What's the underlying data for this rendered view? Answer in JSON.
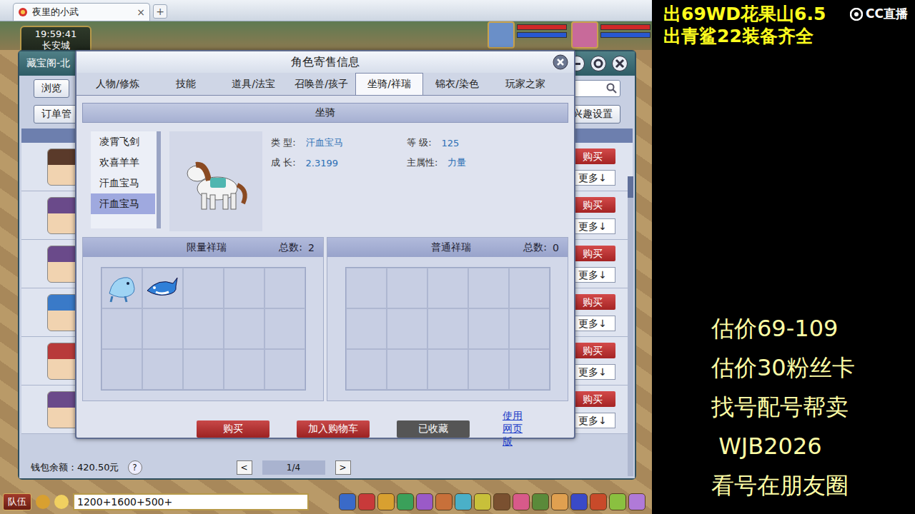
{
  "browser": {
    "tab_title": "夜里的小武",
    "close": "×",
    "new_tab": "+"
  },
  "hud": {
    "time": "19:59:41",
    "location": "长安城"
  },
  "market": {
    "title": "藏宝阁-北",
    "browse": "浏览",
    "orders": "订单管",
    "interest": "兴趣设置",
    "rows": [
      {
        "buy": "购买",
        "more": "更多↓",
        "color": "#5a3a2a"
      },
      {
        "buy": "购买",
        "more": "更多↓",
        "color": "#6a4a8a"
      },
      {
        "buy": "购买",
        "more": "更多↓",
        "color": "#6a4a8a"
      },
      {
        "buy": "购买",
        "more": "更多↓",
        "color": "#3a7ac8"
      },
      {
        "buy": "购买",
        "more": "更多↓",
        "color": "#b83a3a"
      },
      {
        "buy": "购买",
        "more": "更多↓",
        "color": "#6a4a8a"
      }
    ],
    "wallet": "钱包余额：420.50元",
    "help": "?",
    "prev": "<",
    "page": "1/4",
    "next": ">"
  },
  "dialog": {
    "title": "角色寄售信息",
    "tabs": [
      {
        "label": "人物/修炼",
        "selected": false
      },
      {
        "label": "技能",
        "selected": false
      },
      {
        "label": "道具/法宝",
        "selected": false
      },
      {
        "label": "召唤兽/孩子",
        "selected": false
      },
      {
        "label": "坐骑/祥瑞",
        "selected": true
      },
      {
        "label": "锦衣/染色",
        "selected": false
      },
      {
        "label": "玩家之家",
        "selected": false
      }
    ],
    "section": "坐骑",
    "mounts": [
      {
        "name": "凌霄飞剑",
        "selected": false
      },
      {
        "name": "欢喜羊羊",
        "selected": false
      },
      {
        "name": "汗血宝马",
        "selected": false
      },
      {
        "name": "汗血宝马",
        "selected": true
      }
    ],
    "details": [
      {
        "label": "类 型:",
        "value": "汗血宝马"
      },
      {
        "label": "等 级:",
        "value": "125"
      },
      {
        "label": "成 长:",
        "value": "2.3199"
      },
      {
        "label": "主属性:",
        "value": "力量"
      }
    ],
    "xiangrui": [
      {
        "title": "限量祥瑞",
        "count_label": "总数:",
        "count": "2",
        "items": [
          {
            "kind": "beast"
          },
          {
            "kind": "shark"
          }
        ]
      },
      {
        "title": "普通祥瑞",
        "count_label": "总数:",
        "count": "0",
        "items": []
      }
    ],
    "buttons": [
      {
        "label": "购买",
        "kind": "primary"
      },
      {
        "label": "加入购物车",
        "kind": "primary"
      },
      {
        "label": "已收藏",
        "kind": "done"
      },
      {
        "label": "使用网页版",
        "kind": "link"
      }
    ]
  },
  "chat": {
    "channel": "队伍",
    "input": "1200+1600+500+"
  },
  "stream": {
    "headlines": [
      "出69WD花果山6.5",
      "出青鲨22装备齐全"
    ],
    "logo": "CC直播",
    "notes": [
      "估价69-109",
      "估价30粉丝卡",
      "找号配号帮卖",
      " WJB2026",
      "看号在朋友圈"
    ]
  }
}
